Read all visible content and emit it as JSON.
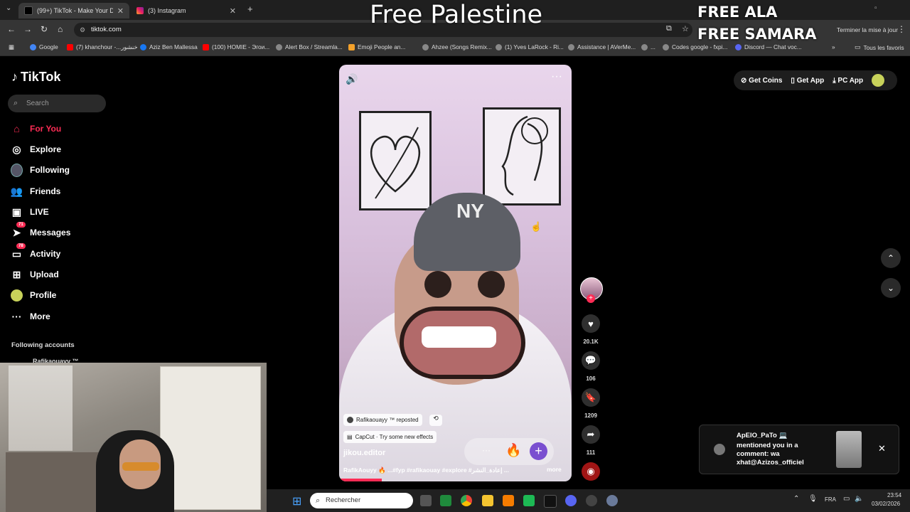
{
  "overlays": {
    "free_palestine": "Free Palestine",
    "free_ala": "FREE ALA",
    "free_samara": "FREE SAMARA"
  },
  "browser": {
    "tabs": [
      {
        "title": "(99+) TikTok - Make Your D...",
        "active": true
      },
      {
        "title": "(3) Instagram",
        "active": false
      }
    ],
    "url": "tiktok.com",
    "update_button": "Terminer la mise à jour",
    "bookmarks": [
      "Google",
      "(7) khanchour -...خنشور",
      "Aziz Ben Mallessa",
      "(100) HOMIE - Эгои...",
      "Alert Box / Streamla...",
      "Emoji People an...",
      "Ahzee (Songs Remix...",
      "(1) Yves LaRock - Ri...",
      "Assistance | AVerMe...",
      "...",
      "Codes google - fxpi...",
      "Discord — Chat voc...",
      "Tous les favoris"
    ]
  },
  "tiktok": {
    "logo": "TikTok",
    "search_placeholder": "Search",
    "nav": [
      {
        "label": "For You",
        "icon": "home-icon",
        "active": true
      },
      {
        "label": "Explore",
        "icon": "compass-icon"
      },
      {
        "label": "Following",
        "icon": "avatar-icon"
      },
      {
        "label": "Friends",
        "icon": "friends-icon"
      },
      {
        "label": "LIVE",
        "icon": "live-icon"
      },
      {
        "label": "Messages",
        "icon": "messages-icon",
        "badge": "71"
      },
      {
        "label": "Activity",
        "icon": "activity-icon",
        "badge": "78"
      },
      {
        "label": "Upload",
        "icon": "upload-icon"
      },
      {
        "label": "Profile",
        "icon": "profile-avatar-icon"
      },
      {
        "label": "More",
        "icon": "more-dots-icon"
      }
    ],
    "following_accounts_title": "Following accounts",
    "following_account_1": "Rafikaouayy ™",
    "top_buttons": {
      "get_coins": "Get Coins",
      "get_app": "Get App",
      "pc_app": "PC App"
    },
    "video": {
      "repost_text": "Rafikaouayy ™ reposted",
      "effect_text": "CapCut · Try some new effects",
      "author": "jikou.editor",
      "caption": "RafikAouyy 🔥 ...#fyp #rafikaouay #explore #إعادة_النشر ...",
      "more_label": "more"
    },
    "actions": {
      "likes": "20.1K",
      "comments": "106",
      "saves": "1209",
      "shares": "111"
    },
    "notification": {
      "user": "ApEIO_PaTo 💻",
      "text": "mentioned you in a comment: wa xhat@Azizos_officiel"
    }
  },
  "taskbar": {
    "search_placeholder": "Rechercher",
    "lang": "FRA",
    "time": "23:54",
    "date": "03/02/2026"
  },
  "colors": {
    "accent": "#fe2c55",
    "chrome_bg": "#1f1f1f",
    "toolbar_bg": "#353535"
  }
}
